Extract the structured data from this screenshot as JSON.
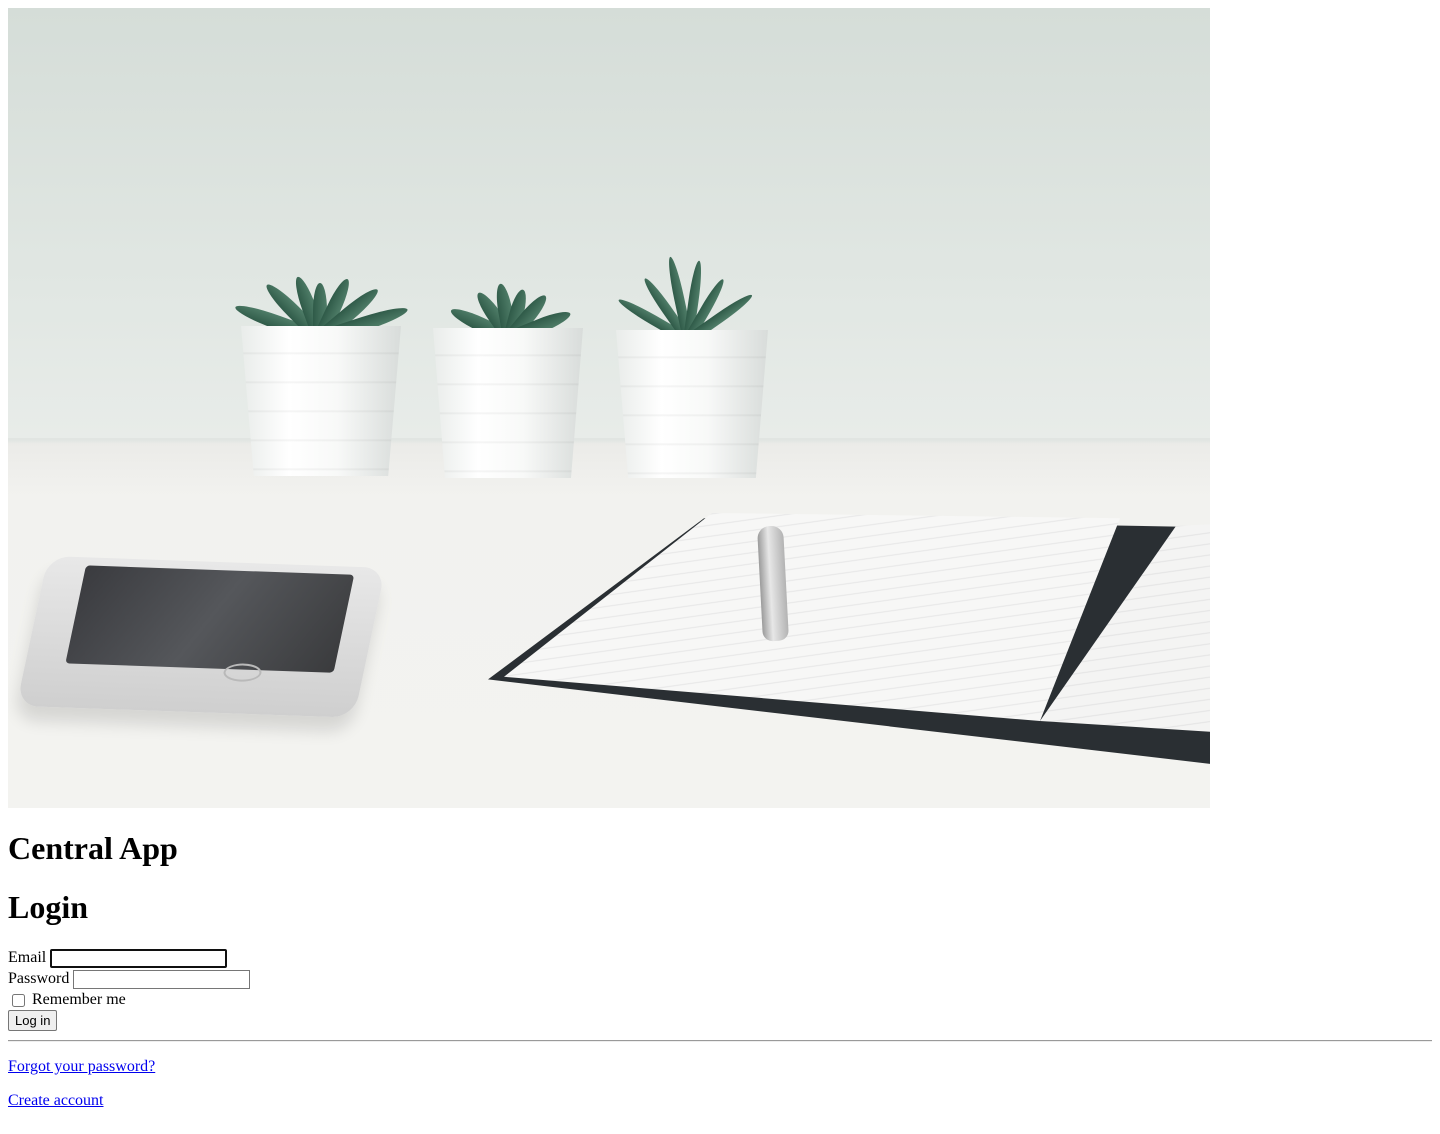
{
  "app": {
    "name": "Central App"
  },
  "login": {
    "heading": "Login",
    "email_label": "Email",
    "email_value": "",
    "password_label": "Password",
    "password_value": "",
    "remember_label": "Remember me",
    "remember_checked": false,
    "submit_label": "Log in"
  },
  "links": {
    "forgot_password": "Forgot your password?",
    "create_account": "Create account"
  },
  "hero": {
    "icon": "workspace-photo"
  }
}
